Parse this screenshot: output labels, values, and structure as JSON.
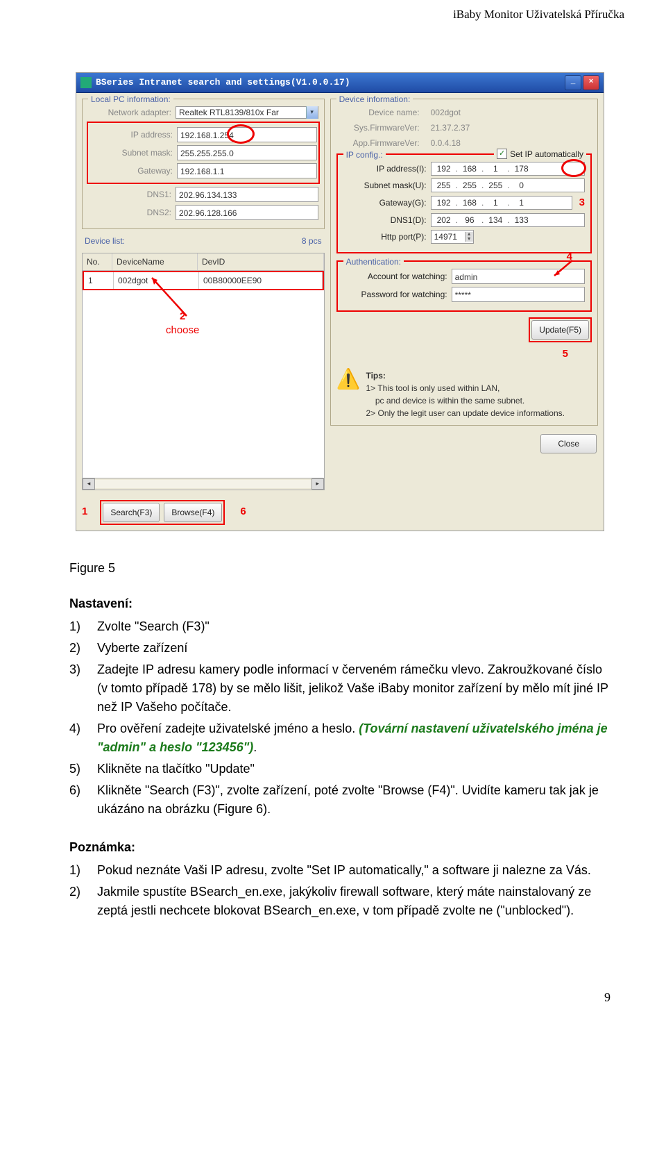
{
  "header": "iBaby Monitor Uživatelská Příručka",
  "win": {
    "title": "BSeries Intranet search and settings(V1.0.0.17)"
  },
  "localpc": {
    "label": "Local PC information:",
    "adapter_lbl": "Network adapter:",
    "adapter": "Realtek RTL8139/810x Far",
    "ip_lbl": "IP address:",
    "ip": "192.168.1.254",
    "subnet_lbl": "Subnet mask:",
    "subnet": "255.255.255.0",
    "gw_lbl": "Gateway:",
    "gw": "192.168.1.1",
    "dns1_lbl": "DNS1:",
    "dns1": "202.96.134.133",
    "dns2_lbl": "DNS2:",
    "dns2": "202.96.128.166"
  },
  "devlist": {
    "label": "Device list:",
    "count": "8 pcs",
    "h_no": "No.",
    "h_name": "DeviceName",
    "h_id": "DevID",
    "r_no": "1",
    "r_name": "002dgot",
    "r_id": "00B80000EE90",
    "choose": "choose",
    "search": "Search(F3)",
    "browse": "Browse(F4)"
  },
  "devinfo": {
    "label": "Device information:",
    "dname_lbl": "Device name:",
    "dname": "002dgot",
    "sysfw_lbl": "Sys.FirmwareVer:",
    "sysfw": "21.37.2.37",
    "appfw_lbl": "App.FirmwareVer:",
    "appfw": "0.0.4.18"
  },
  "ipconf": {
    "label": "IP config.:",
    "setip": "Set IP automatically",
    "ip_lbl": "IP address(I):",
    "ip": [
      "192",
      "168",
      "1",
      "178"
    ],
    "sn_lbl": "Subnet mask(U):",
    "sn": [
      "255",
      "255",
      "255",
      "0"
    ],
    "gw_lbl": "Gateway(G):",
    "gw": [
      "192",
      "168",
      "1",
      "1"
    ],
    "dns_lbl": "DNS1(D):",
    "dns": [
      "202",
      "96",
      "134",
      "133"
    ],
    "port_lbl": "Http port(P):",
    "port": "14971"
  },
  "auth": {
    "label": "Authentication:",
    "acc_lbl": "Account for watching:",
    "acc": "admin",
    "pw_lbl": "Password for watching:",
    "pw": "*****",
    "update": "Update(F5)"
  },
  "tips": {
    "head": "Tips:",
    "l1": "1> This tool is only used within LAN,",
    "l2": "pc and device is within the same subnet.",
    "l3": "2> Only the legit user can update  device informations.",
    "close": "Close"
  },
  "ann": {
    "n1": "1",
    "n2": "2",
    "n3": "3",
    "n4": "4",
    "n5": "5",
    "n6": "6"
  },
  "doc": {
    "figlabel": "Figure 5",
    "setup_head": "Nastavení:",
    "s1": "Zvolte \"Search (F3)\"",
    "s2": "Vyberte zařízení",
    "s3": "Zadejte IP adresu kamery podle informací v červeném rámečku vlevo. Zakroužkované číslo (v tomto případě 178) by se mělo lišit, jelikož Vaše iBaby monitor zařízení by mělo mít jiné IP než IP Vašeho počítače.",
    "s4a": "Pro ověření zadejte uživatelské jméno a heslo. ",
    "s4b": "(Tovární nastavení uživatelského jména je \"admin\" a heslo \"123456\")",
    "s4c": ".",
    "s5": "Klikněte na tlačítko \"Update\"",
    "s6": "Klikněte \"Search (F3)\", zvolte zařízení, poté zvolte \"Browse (F4)\". Uvidíte kameru tak jak je ukázáno na obrázku (Figure 6).",
    "note_head": "Poznámka:",
    "n1": "Pokud neznáte Vaši IP adresu, zvolte \"Set IP automatically,\" a software ji nalezne za Vás.",
    "n2": "Jakmile spustíte BSearch_en.exe, jakýkoliv firewall software, který máte nainstalovaný ze zeptá jestli nechcete blokovat BSearch_en.exe, v tom případě zvolte ne (\"unblocked\")."
  },
  "pagenum": "9"
}
